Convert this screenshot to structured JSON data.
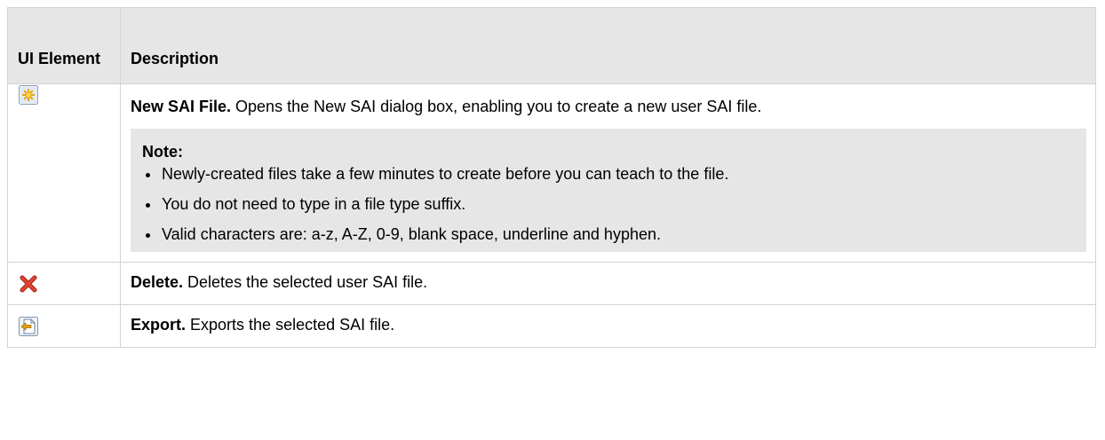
{
  "header": {
    "col1": "UI Element",
    "col2": "Description"
  },
  "rows": [
    {
      "icon": "new-file-icon",
      "title": "New SAI File.",
      "text": " Opens the New SAI dialog box, enabling you to create a new user SAI file."
    },
    {
      "icon": "delete-icon",
      "title": "Delete.",
      "text": " Deletes the selected user SAI file."
    },
    {
      "icon": "export-icon",
      "title": "Export.",
      "text": " Exports the selected SAI file."
    }
  ],
  "note": {
    "title": "Note:",
    "items": [
      "Newly-created files take a few minutes to create before you can teach to the file.",
      "You do not need to type in a file type suffix.",
      "Valid characters are: a-z, A-Z, 0-9, blank space, underline and hyphen."
    ]
  }
}
